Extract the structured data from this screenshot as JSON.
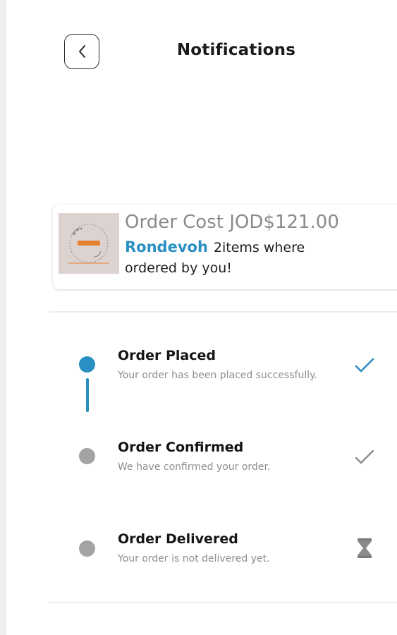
{
  "header": {
    "title": "Notifications",
    "back_icon": "chevron-left-icon"
  },
  "order": {
    "cost_text": "Order Cost JOD$121.00",
    "store_name": "Rondevoh",
    "description": "2items where ordered by you!"
  },
  "timeline": [
    {
      "title": "Order Placed",
      "subtitle": "Your order has been placed successfully.",
      "status_icon": "checkmark-icon",
      "dot_color": "#2a8fc1",
      "status_color": "#2a8fc1"
    },
    {
      "title": "Order Confirmed",
      "subtitle": "We have confirmed your order.",
      "status_icon": "checkmark-icon",
      "dot_color": "#a3a3a3",
      "status_color": "#8a8a8a"
    },
    {
      "title": "Order Delivered",
      "subtitle": "Your order is not delivered yet.",
      "status_icon": "hourglass-icon",
      "dot_color": "#a3a3a3",
      "status_color": "#8a8a8a"
    }
  ],
  "colors": {
    "accent": "#2a8fc1",
    "inactive": "#a3a3a3"
  }
}
